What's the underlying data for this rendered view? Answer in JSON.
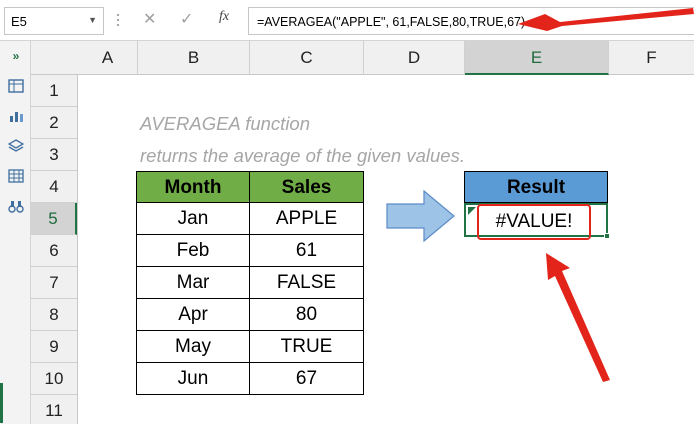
{
  "formula_bar": {
    "name_box": "E5",
    "formula": "=AVERAGEA(\"APPLE\", 61,FALSE,80,TRUE,67)",
    "cancel_icon": "✕",
    "enter_icon": "✓",
    "fx_label": "fx"
  },
  "columns": [
    "A",
    "B",
    "C",
    "D",
    "E",
    "F"
  ],
  "selected_column": "E",
  "rows": [
    "1",
    "2",
    "3",
    "4",
    "5",
    "6",
    "7",
    "8",
    "9",
    "10",
    "11"
  ],
  "selected_row": "5",
  "description": {
    "line1": "AVERAGEA function",
    "line2": "returns the average of the given values."
  },
  "table": {
    "headers": [
      "Month",
      "Sales"
    ],
    "rows": [
      [
        "Jan",
        "APPLE"
      ],
      [
        "Feb",
        "61"
      ],
      [
        "Mar",
        "FALSE"
      ],
      [
        "Apr",
        "80"
      ],
      [
        "May",
        "TRUE"
      ],
      [
        "Jun",
        "67"
      ]
    ],
    "header_color": "#70ad47"
  },
  "result": {
    "header": "Result",
    "value": "#VALUE!",
    "header_color": "#5b9bd5"
  },
  "colors": {
    "accent": "#217346",
    "annotation": "#e3241b",
    "arrow_fill": "#9dc3e6"
  },
  "sidebar_icons": [
    "expand-icon",
    "table-icon",
    "chart-icon",
    "layers-icon",
    "grid-icon",
    "binoculars-icon"
  ]
}
